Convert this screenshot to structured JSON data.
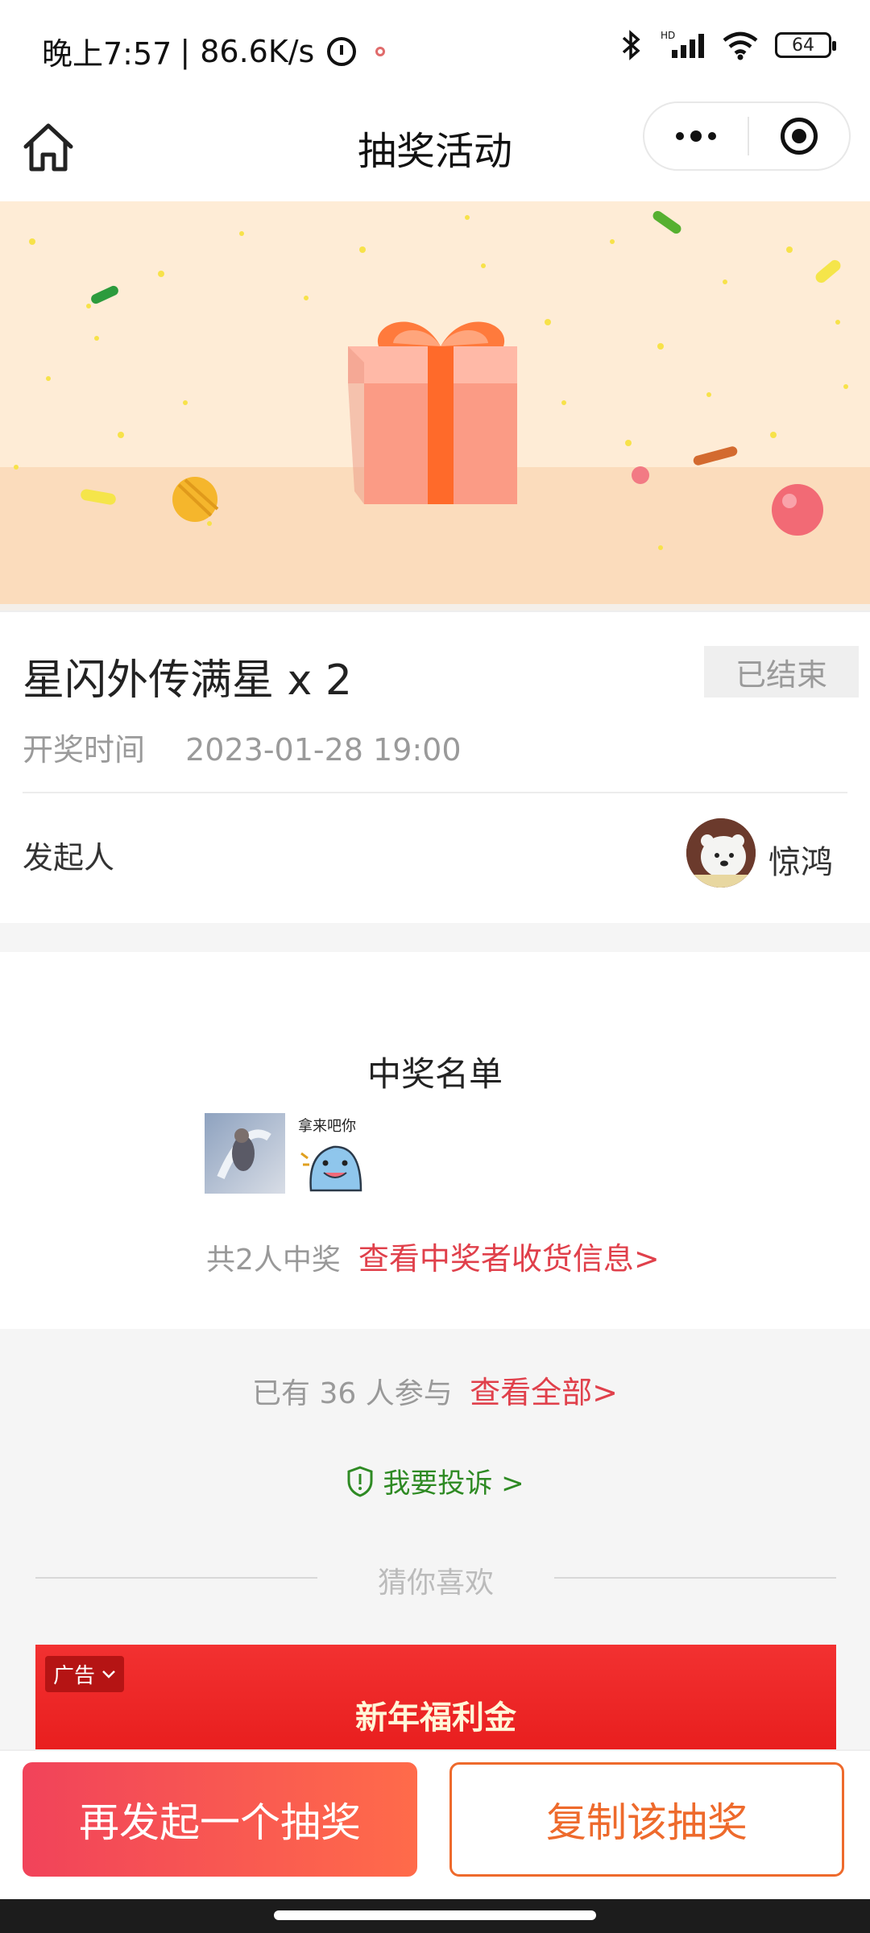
{
  "status_bar": {
    "time": "晚上7:57",
    "speed": "| 86.6K/s",
    "battery": "64"
  },
  "nav": {
    "title": "抽奖活动"
  },
  "prize": {
    "title": "星闪外传满星 x 2",
    "status": "已结束",
    "draw_time_label": "开奖时间",
    "draw_time_value": "2023-01-28 19:00",
    "initiator_label": "发起人",
    "initiator_name": "惊鸿"
  },
  "winners": {
    "title": "中奖名单",
    "count_text": "共2人中奖",
    "shipping_link": "查看中奖者收货信息>"
  },
  "participants": {
    "text": "已有 36 人参与",
    "view_all": "查看全部>"
  },
  "complain": {
    "label": "我要投诉 >"
  },
  "recommend": {
    "title": "猜你喜欢"
  },
  "ad": {
    "tag": "广告",
    "title": "新年福利金"
  },
  "actions": {
    "restart": "再发起一个抽奖",
    "copy": "复制该抽奖"
  },
  "colors": {
    "accent_red": "#e0404b",
    "accent_orange": "#ee6a2c",
    "complain_green": "#2e8a23"
  }
}
